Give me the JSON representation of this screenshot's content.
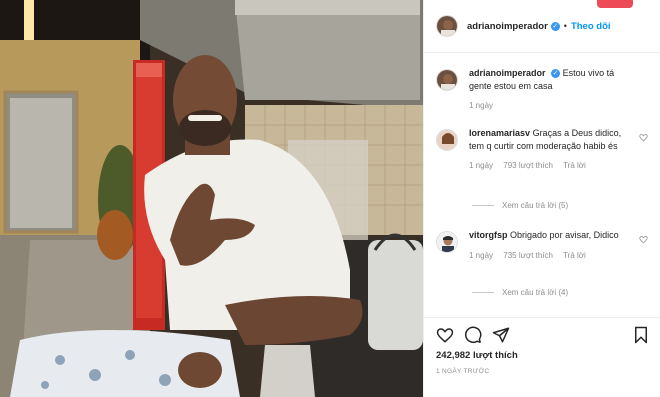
{
  "post": {
    "author": "adrianoimperador",
    "verified": true,
    "follow_label": "Theo dõi",
    "separator": "•"
  },
  "caption": {
    "username": "adrianoimperador",
    "text": "Estou vivo tá gente estou em casa",
    "time": "1 ngày"
  },
  "comments": [
    {
      "username": "lorenamariasv",
      "text": "Graças a Deus didico, tem q curtir com moderação habib és",
      "time": "1 ngày",
      "likes": "793 lượt thích",
      "reply_label": "Trả lời",
      "view_replies": "Xem câu trả lời (5)"
    },
    {
      "username": "vitorgfsp",
      "text": "Obrigado por avisar, Didico",
      "time": "1 ngày",
      "likes": "735 lượt thích",
      "reply_label": "Trả lời",
      "view_replies": "Xem câu trả lời (4)"
    }
  ],
  "actions": {
    "like_icon": "heart-icon",
    "comment_icon": "comment-icon",
    "share_icon": "share-icon",
    "save_icon": "bookmark-icon"
  },
  "likes": {
    "count": "242,982",
    "label": "lượt thích"
  },
  "timestamp": "1 NGÀY TRƯỚC",
  "colors": {
    "accent": "#0095f6",
    "verified": "#3897f0",
    "muted": "#8e8e8e",
    "top_button": "#ed4956"
  }
}
